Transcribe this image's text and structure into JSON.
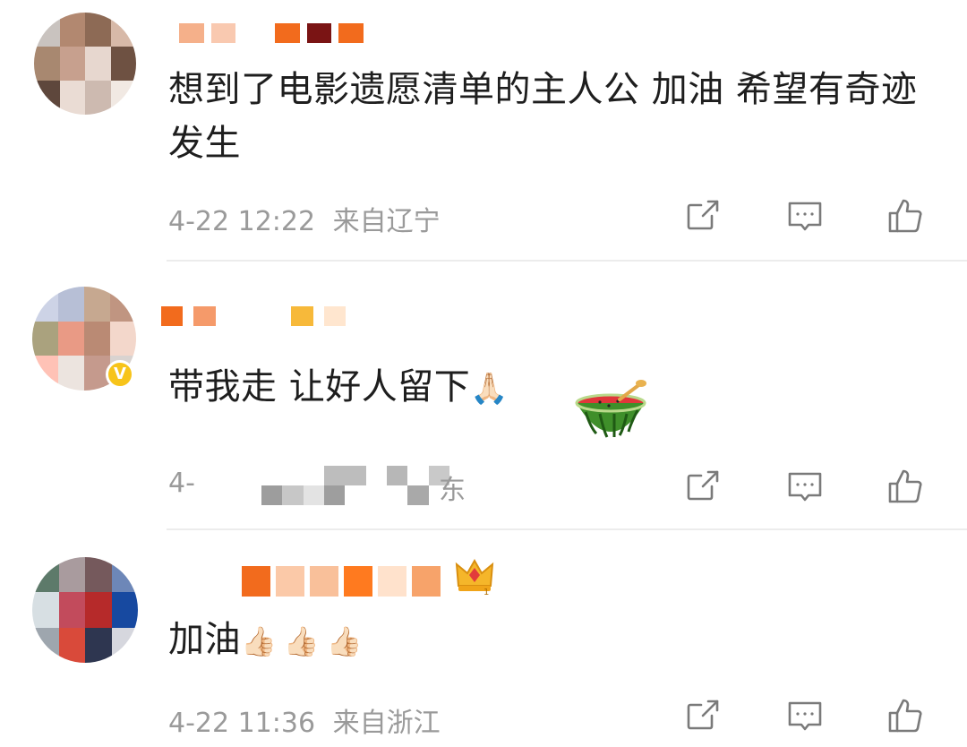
{
  "comments": [
    {
      "text": "想到了电影遗愿清单的主人公 加油 希望有奇迹发生",
      "time": "4-22 12:22",
      "location": "来自辽宁",
      "name_mosaic": [
        "#f5b08a",
        "#f9c9b0",
        "#ffffff",
        "#f26b1d",
        "#7a1414",
        "#f26b1d"
      ],
      "avatar_mosaic": [
        "#c9c3bf",
        "#b28870",
        "#8d6a55",
        "#d7b9a8",
        "#a88870",
        "#c7a08e",
        "#e7d7cf",
        "#6e5142",
        "#5e473c",
        "#eadcd4",
        "#cdbab0",
        "#f1e9e3"
      ]
    },
    {
      "text": "带我走 让好人留下",
      "emoji": "🙏🏻",
      "time_partial": "4-",
      "location_partial": "东",
      "name_mosaic": [
        "#f26b1d",
        "#f59a6a",
        "#ffffff",
        "#ffffff",
        "#f7b93a",
        "#ffe6cf"
      ],
      "avatar_mosaic": [
        "#cdd3e6",
        "#b7bfd6",
        "#c6a890",
        "#c09581",
        "#aaa27e",
        "#e99a85",
        "#ba8a74",
        "#f3d7cb",
        "#ffc2b6",
        "#ece4df",
        "#c59a8d",
        "#d9d3d0"
      ]
    },
    {
      "text": "加油",
      "emoji": "👍🏻👍🏻👍🏻",
      "time": "4-22 11:36",
      "location": "来自浙江",
      "name_mosaic": [
        "#f26b1d",
        "#fbc9a8",
        "#f9c09a",
        "#ff7a1f",
        "#ffe2cc",
        "#f7a36a"
      ],
      "avatar_mosaic": [
        "#5d7a6a",
        "#a99b9e",
        "#75595c",
        "#6d87b8",
        "#d7dfe3",
        "#c24b5c",
        "#b62a2a",
        "#1749a0",
        "#9ea6ae",
        "#d94a3a",
        "#2e3650",
        "#d6d7de"
      ]
    }
  ],
  "actions": {
    "share_icon": "edit-share-icon",
    "reply_icon": "comment-bubble-icon",
    "like_icon": "thumbs-up-icon"
  },
  "colors": {
    "text": "#1e1e1e",
    "meta": "#9a9a9a",
    "icon": "#7a7a7a",
    "divider": "#ececec"
  }
}
